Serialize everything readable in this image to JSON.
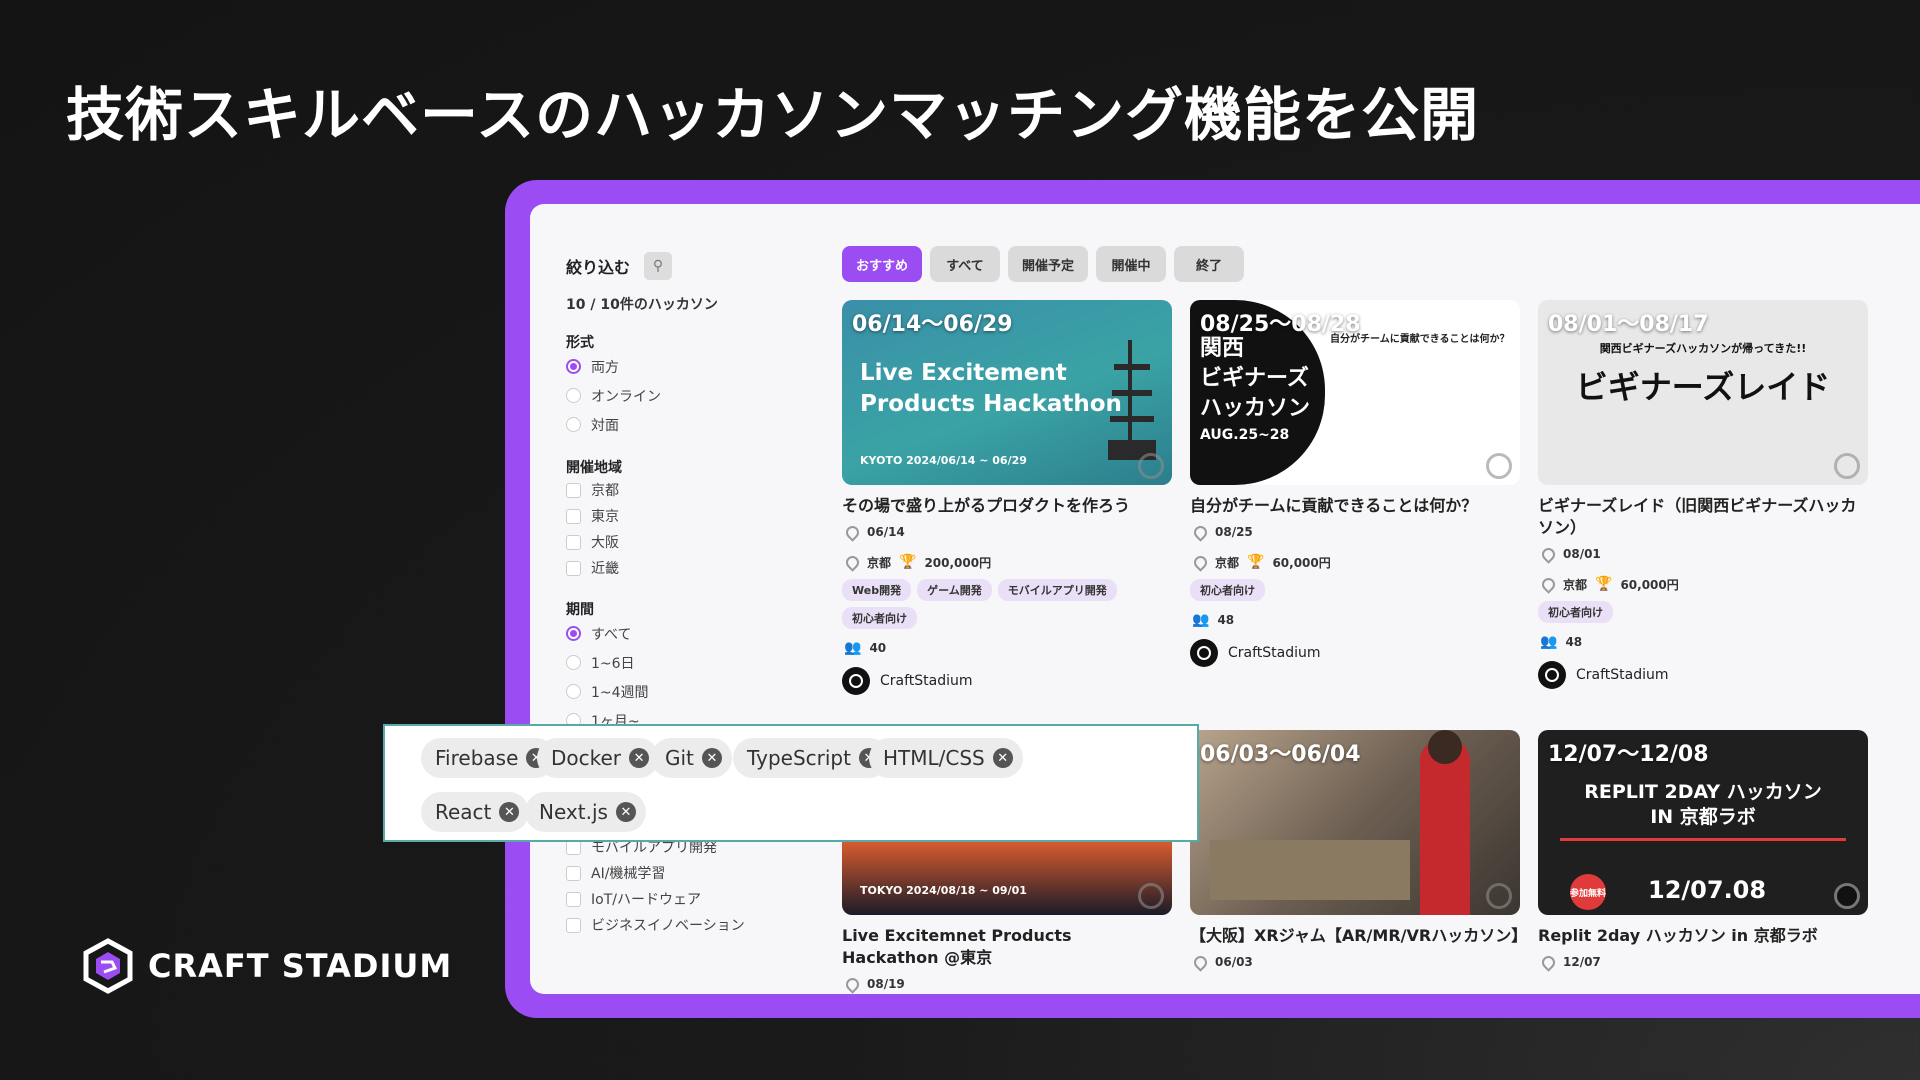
{
  "headline": "技術スキルベースのハッカソンマッチング機能を公開",
  "sidebar": {
    "title": "絞り込む",
    "count": "10 / 10件のハッカソン",
    "format": {
      "title": "形式",
      "options": [
        "両方",
        "オンライン",
        "対面"
      ],
      "selected": 0
    },
    "region": {
      "title": "開催地域",
      "options": [
        "京都",
        "東京",
        "大阪",
        "近畿"
      ]
    },
    "period": {
      "title": "期間",
      "options": [
        "すべて",
        "1~6日",
        "1~4週間",
        "1ヶ月~"
      ],
      "selected": 0
    },
    "more_options": [
      "モバイルアプリ開発",
      "AI/機械学習",
      "IoT/ハードウェア",
      "ビジネスイノベーション"
    ]
  },
  "tabs": [
    "おすすめ",
    "すべて",
    "開催予定",
    "開催中",
    "終了"
  ],
  "cards": [
    {
      "date": "06/14〜06/29",
      "banner": [
        "Live Excitement",
        "Products Hackathon"
      ],
      "banner_sub": "KYOTO  2024/06/14 ~ 06/29",
      "title": "その場で盛り上がるプロダクトを作ろう",
      "start": "06/14",
      "location": "京都",
      "prize": "200,000円",
      "tags": [
        "Web開発",
        "ゲーム開発",
        "モバイルアプリ開発",
        "初心者向け"
      ],
      "participants": "40",
      "organizer": "CraftStadium"
    },
    {
      "date": "08/25〜08/28",
      "banner": [
        "関西",
        "ビギナーズ",
        "ハッカソン",
        "AUG.25~28"
      ],
      "banner_sub": "自分がチームに貢献できることは何か？",
      "title": "自分がチームに貢献できることは何か？",
      "start": "08/25",
      "location": "京都",
      "prize": "60,000円",
      "tags": [
        "初心者向け"
      ],
      "participants": "48",
      "organizer": "CraftStadium"
    },
    {
      "date": "08/01〜08/17",
      "banner": [
        "ビギナーズレイド"
      ],
      "banner_sub": "関西ビギナーズハッカソンが帰ってきた!!",
      "title": "ビギナーズレイド（旧関西ビギナーズハッカソン）",
      "start": "08/01",
      "location": "京都",
      "prize": "60,000円",
      "tags": [
        "初心者向け"
      ],
      "participants": "48",
      "organizer": "CraftStadium"
    },
    {
      "date": "",
      "banner_sub": "TOKYO  2024/08/18 ~ 09/01",
      "title": "Live Excitemnet Products Hackathon @東京",
      "start": "08/19"
    },
    {
      "date": "06/03〜06/04",
      "title": "【大阪】XRジャム【AR/MR/VRハッカソン】",
      "start": "06/03"
    },
    {
      "date": "12/07〜12/08",
      "banner": [
        "REPLIT 2DAY ハッカソン",
        "IN 京都ラボ",
        "12/07.08"
      ],
      "banner_sub": "参加無料",
      "title": "Replit 2day ハッカソン in 京都ラボ",
      "start": "12/07"
    }
  ],
  "skill_chips": [
    "Firebase",
    "Docker",
    "Git",
    "TypeScript",
    "HTML/CSS",
    "React",
    "Next.js"
  ],
  "brand": "CRAFT STADIUM",
  "colors": {
    "accent": "#9b4cf2",
    "background": "#161616"
  }
}
